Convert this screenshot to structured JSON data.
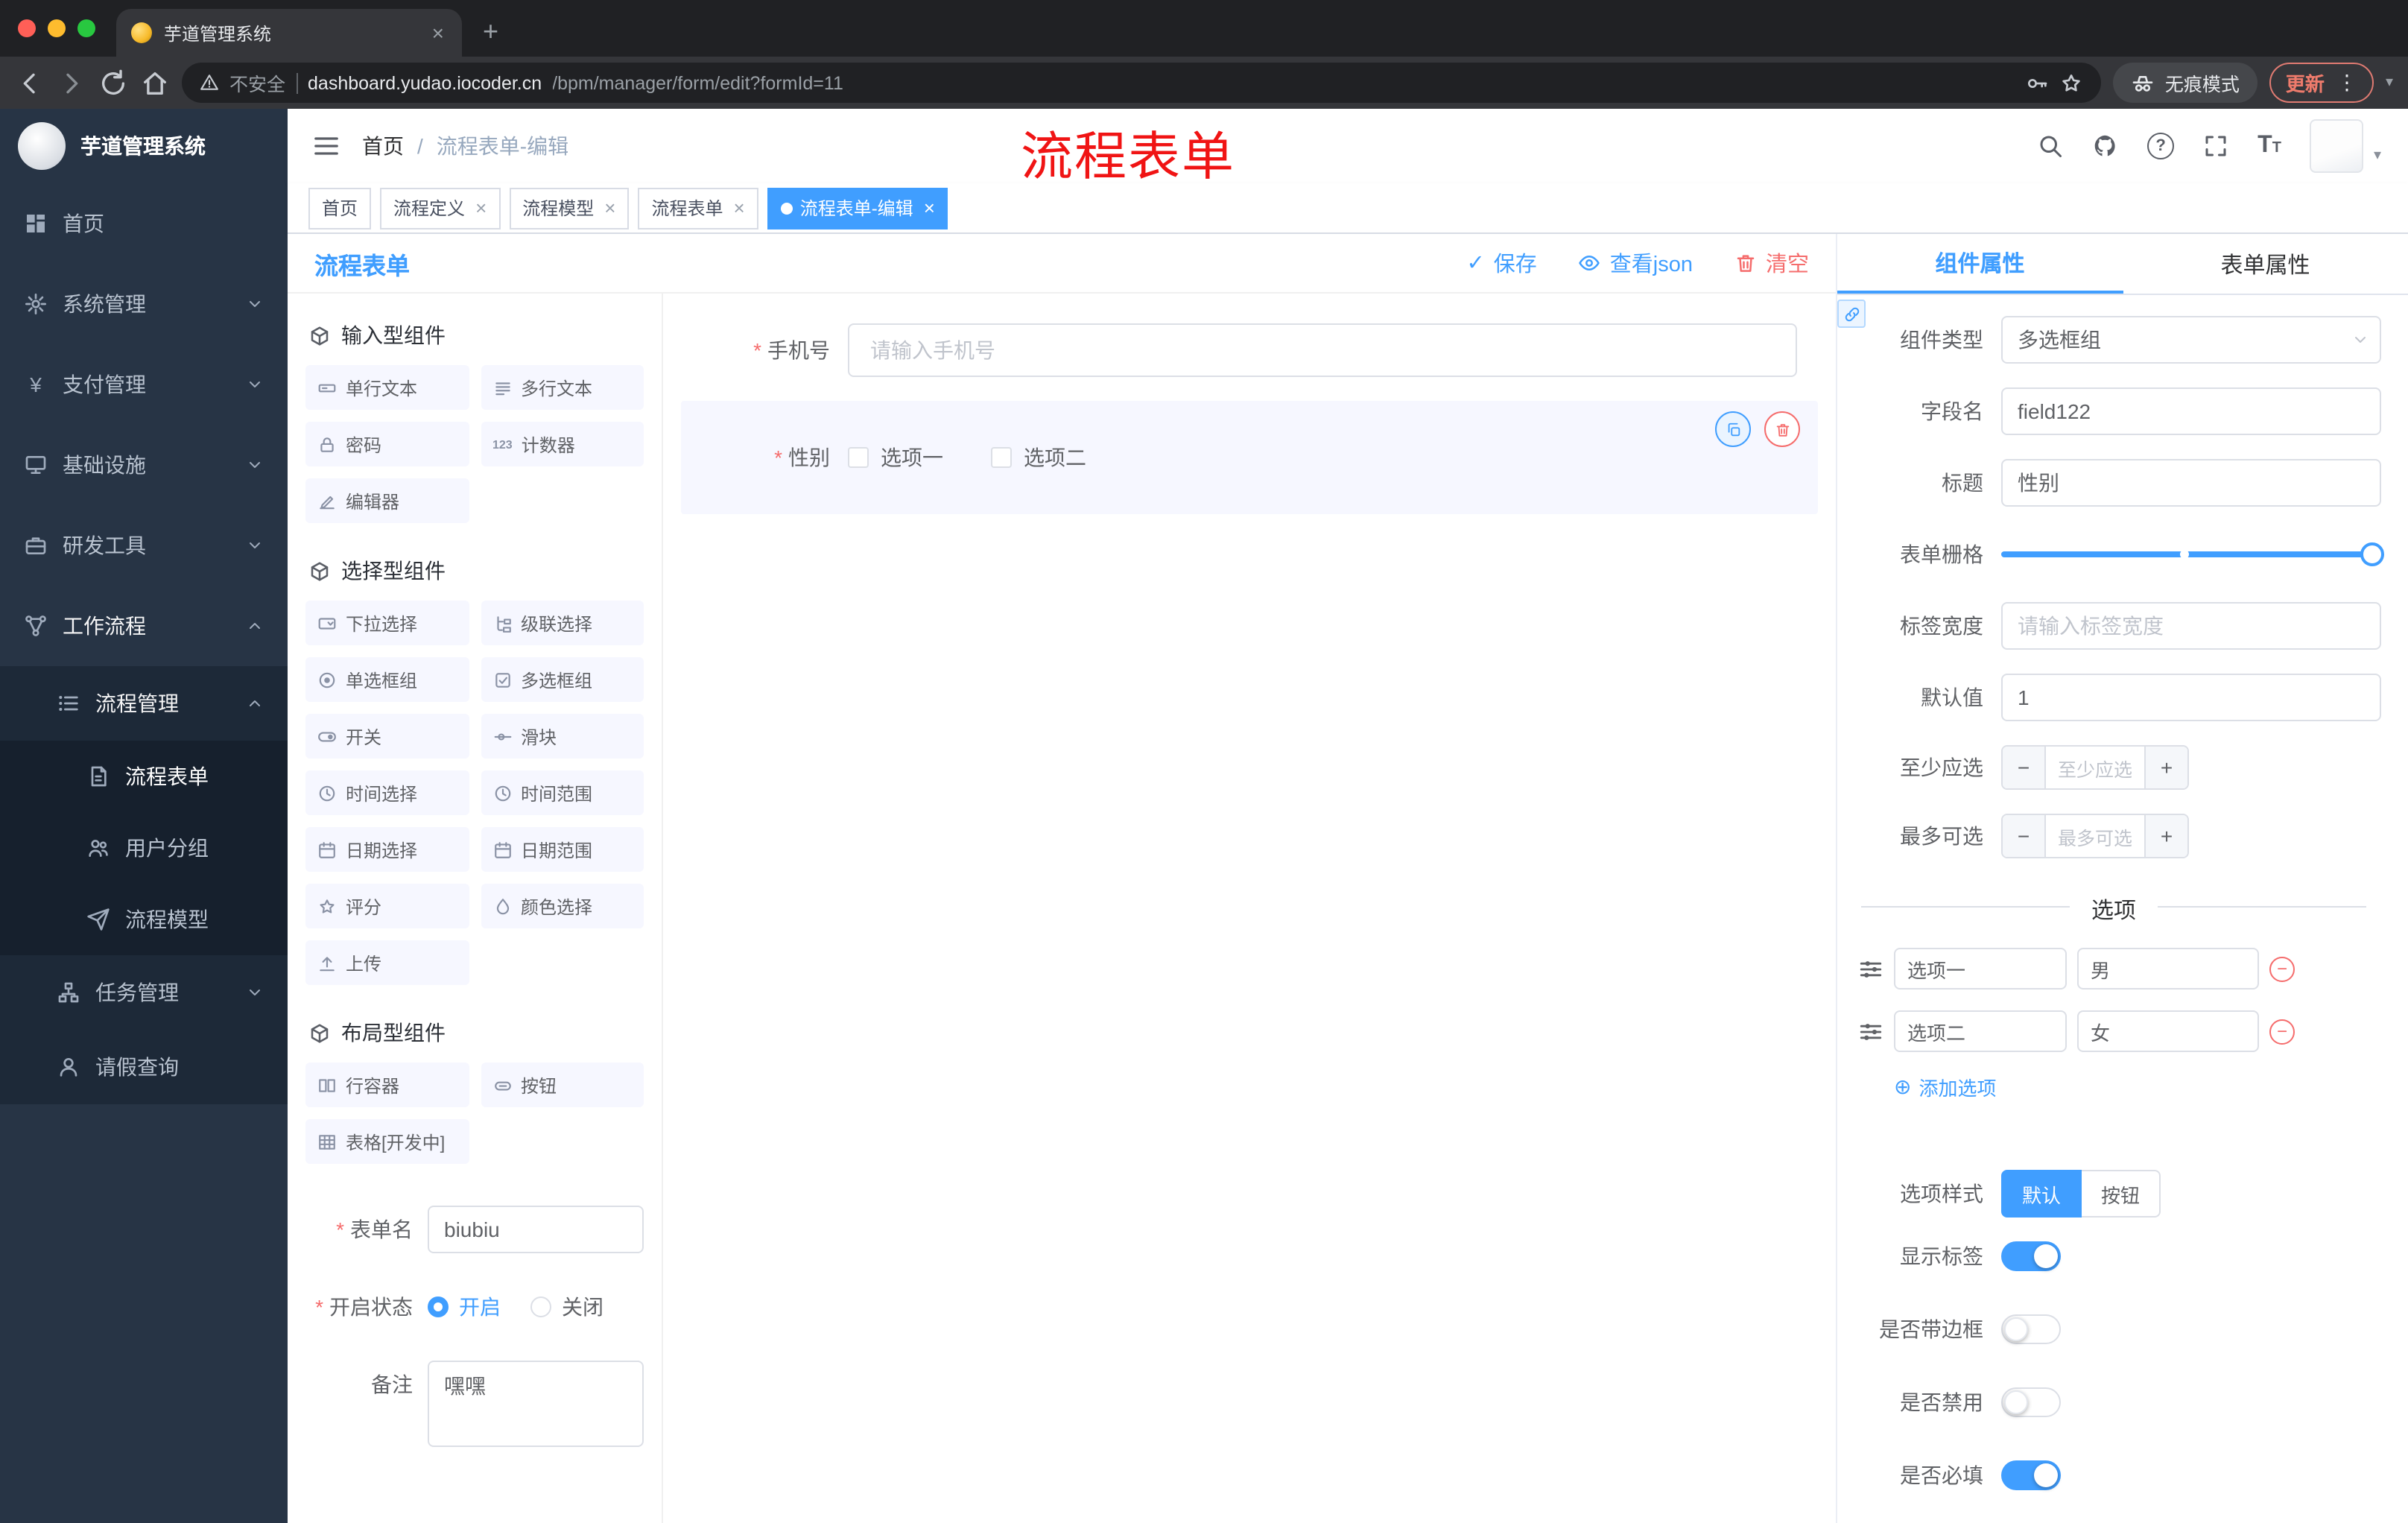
{
  "colors": {
    "primary": "#409eff",
    "danger": "#f56c6c",
    "annotation": "#f01414",
    "sidebar_bg": "#273445",
    "active_tag": "#409eff"
  },
  "icons": {
    "close": "×",
    "plus": "+",
    "minus": "−",
    "dots": "⋮",
    "caret_down": "▾",
    "check": "✓",
    "circle_plus": "⊕",
    "yen": "¥",
    "counter": "123",
    "question": "?",
    "t": "T",
    "breadcrumb_sep": "/"
  },
  "browser": {
    "tab_title": "芋道管理系统",
    "address": {
      "security": "不安全",
      "host": "dashboard.yudao.iocoder.cn",
      "path": "/bpm/manager/form/edit?formId=11"
    },
    "incognito_label": "无痕模式",
    "update_label": "更新"
  },
  "sidebar": {
    "logo_title": "芋道管理系统",
    "items": [
      {
        "label": "首页"
      },
      {
        "label": "系统管理"
      },
      {
        "label": "支付管理"
      },
      {
        "label": "基础设施"
      },
      {
        "label": "研发工具"
      },
      {
        "label": "工作流程"
      }
    ],
    "process_mgmt": {
      "label": "流程管理",
      "children": [
        {
          "label": "流程表单"
        },
        {
          "label": "用户分组"
        },
        {
          "label": "流程模型"
        }
      ]
    },
    "task_mgmt": {
      "label": "任务管理"
    },
    "leave_query": {
      "label": "请假查询"
    }
  },
  "header": {
    "breadcrumb": [
      "首页",
      "流程表单-编辑"
    ],
    "annotation": "流程表单"
  },
  "tags": [
    {
      "label": "首页"
    },
    {
      "label": "流程定义"
    },
    {
      "label": "流程模型"
    },
    {
      "label": "流程表单"
    },
    {
      "label": "流程表单-编辑"
    }
  ],
  "designer": {
    "title": "流程表单",
    "actions": {
      "save": "保存",
      "view_json": "查看json",
      "clear": "清空"
    },
    "groups": [
      {
        "title": "输入型组件",
        "items": [
          "单行文本",
          "多行文本",
          "密码",
          "计数器",
          "编辑器"
        ]
      },
      {
        "title": "选择型组件",
        "items": [
          "下拉选择",
          "级联选择",
          "单选框组",
          "多选框组",
          "开关",
          "滑块",
          "时间选择",
          "时间范围",
          "日期选择",
          "日期范围",
          "评分",
          "颜色选择",
          "上传"
        ]
      },
      {
        "title": "布局型组件",
        "items": [
          "行容器",
          "按钮",
          "表格[开发中]"
        ]
      }
    ],
    "meta": {
      "name_label": "表单名",
      "name_value": "biubiu",
      "name_required": true,
      "status_label": "开启状态",
      "status_required": true,
      "status_on": "开启",
      "status_off": "关闭",
      "status_selected": "开启",
      "remark_label": "备注",
      "remark_value": "嘿嘿"
    },
    "canvas": {
      "phone_label": "手机号",
      "phone_required": true,
      "phone_placeholder": "请输入手机号",
      "gender_label": "性别",
      "gender_required": true,
      "gender_options": [
        "选项一",
        "选项二"
      ]
    }
  },
  "props": {
    "tabs": {
      "component": "组件属性",
      "form": "表单属性",
      "active": "组件属性"
    },
    "type_label": "组件类型",
    "type_value": "多选框组",
    "field_label": "字段名",
    "field_value": "field122",
    "title_label": "标题",
    "title_value": "性别",
    "grid_label": "表单栅格",
    "width_label": "标签宽度",
    "width_placeholder": "请输入标签宽度",
    "default_label": "默认值",
    "default_value": "1",
    "min_label": "至少应选",
    "min_placeholder": "至少应选",
    "max_label": "最多可选",
    "max_placeholder": "最多可选",
    "options_title": "选项",
    "options": [
      {
        "label": "选项一",
        "value": "男"
      },
      {
        "label": "选项二",
        "value": "女"
      }
    ],
    "add_option_label": "添加选项",
    "style_label": "选项样式",
    "style_options": [
      "默认",
      "按钮"
    ],
    "style_selected": "默认",
    "toggles": [
      {
        "label": "显示标签",
        "on": true
      },
      {
        "label": "是否带边框",
        "on": false
      },
      {
        "label": "是否禁用",
        "on": false
      },
      {
        "label": "是否必填",
        "on": true
      }
    ]
  }
}
